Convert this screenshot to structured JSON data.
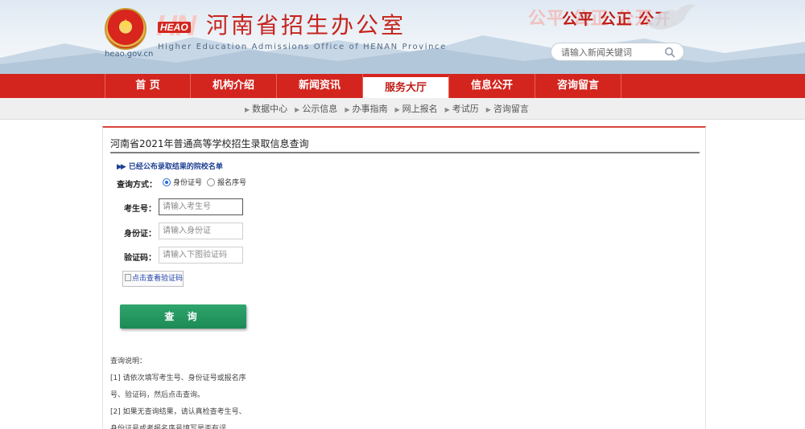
{
  "header": {
    "site_domain": "heao.gov.cn",
    "logo_big": "HN",
    "logo_small": "HEAO",
    "org_title": "河南省招生办公室",
    "org_subtitle": "Higher Education Admissions Office of HENAN Province",
    "slogan_shadow": "公平 公正 公开",
    "slogan": "公平 公正 公开",
    "search_placeholder": "请输入新闻关键词",
    "emblem_icon": "national-emblem-icon",
    "search_icon": "search-icon"
  },
  "nav": {
    "items": [
      "首 页",
      "机构介绍",
      "新闻资讯",
      "服务大厅",
      "信息公开",
      "咨询留言"
    ],
    "active_index": 3
  },
  "subnav": {
    "items": [
      "数据中心",
      "公示信息",
      "办事指南",
      "网上报名",
      "考试历",
      "咨询留言"
    ]
  },
  "panel": {
    "title": "河南省2021年普通高等学校招生录取信息查询",
    "notice_arrow": "▶▶",
    "notice_link": "已经公布录取结果的院校名单",
    "method_label": "查询方式：",
    "method_options": [
      "身份证号",
      "报名序号"
    ],
    "method_selected": "身份证号",
    "fields": {
      "exam_no_label": "考生号：",
      "exam_no_placeholder": "请输入考生号",
      "id_label": "身份证：",
      "id_placeholder": "请输入身份证",
      "captcha_label": "验证码：",
      "captcha_placeholder": "请输入下图验证码"
    },
    "captcha_alt": "点击查看验证码",
    "query_button": "查 询",
    "help": {
      "title": "查询说明：",
      "line1": "[1] 请依次填写考生号、身份证号或报名序",
      "line2": "号、验证码，然后点击查询。",
      "line3": "[2] 如果无查询结果，请认真检查考生号、",
      "line4": "身份证号或者报名序号填写是否有误。"
    }
  },
  "colors": {
    "brand_red": "#d3251e",
    "title_red": "#c7241d",
    "button_green": "#1d8a55",
    "link_blue": "#1c3f94"
  }
}
